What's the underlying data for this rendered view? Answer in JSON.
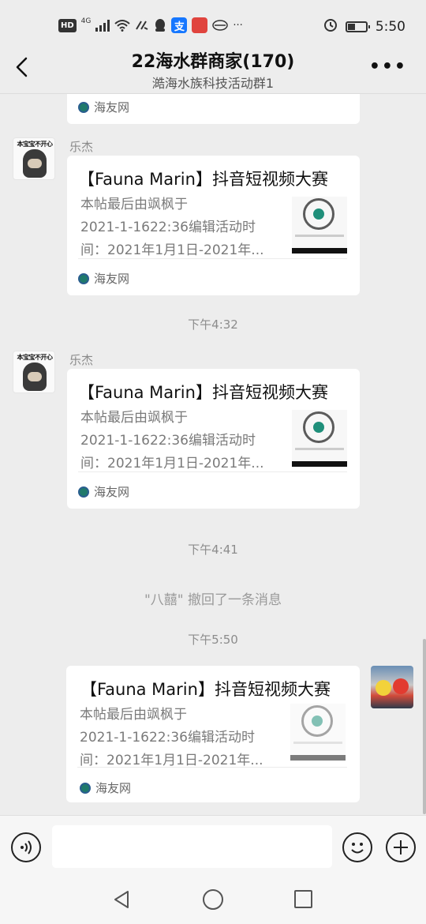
{
  "status_bar": {
    "network_hd": "HD",
    "network_gen": "4G",
    "time": "5:50",
    "icons": [
      "hd-icon",
      "signal-icon",
      "wifi-icon",
      "data-icon",
      "qq-icon",
      "alipay-icon",
      "app-icon",
      "vpn-icon",
      "more-dots-icon",
      "alarm-icon",
      "battery-icon"
    ]
  },
  "header": {
    "title": "22海水群商家(170)",
    "subtitle": "澔海水族科技活动群1",
    "more": "•••"
  },
  "colors": {
    "background": "#ededed",
    "card": "#ffffff",
    "muted_text": "#8c8c8c",
    "source_icon": "#1f7a6b"
  },
  "messages": [
    {
      "type": "card_tail",
      "source": "海友网"
    },
    {
      "type": "card",
      "sender": "乐杰",
      "avatar_caption": "本宝宝不开心",
      "title": "【Fauna Marin】抖音短视频大赛",
      "desc_lines": [
        "本帖最后由飒枫于",
        "2021-1-1622:36编辑活动时",
        "间：2021年1月1日-2021年..."
      ],
      "source": "海友网"
    },
    {
      "type": "timestamp",
      "text": "下午4:32"
    },
    {
      "type": "card",
      "sender": "乐杰",
      "avatar_caption": "本宝宝不开心",
      "title": "【Fauna Marin】抖音短视频大赛",
      "desc_lines": [
        "本帖最后由飒枫于",
        "2021-1-1622:36编辑活动时",
        "间：2021年1月1日-2021年..."
      ],
      "source": "海友网"
    },
    {
      "type": "timestamp",
      "text": "下午4:41"
    },
    {
      "type": "system",
      "text": "\"八囍\" 撤回了一条消息"
    },
    {
      "type": "timestamp",
      "text": "下午5:50"
    },
    {
      "type": "card_self",
      "title": "【Fauna Marin】抖音短视频大赛",
      "desc_lines": [
        "本帖最后由飒枫于",
        "2021-1-1622:36编辑活动时",
        "间：2021年1月1日-2021年..."
      ],
      "source": "海友网"
    }
  ],
  "input_bar": {
    "placeholder": "",
    "icons": [
      "voice-icon",
      "emoji-icon",
      "plus-icon"
    ]
  },
  "system_nav": {
    "icons": [
      "back-triangle-icon",
      "home-circle-icon",
      "recents-square-icon"
    ]
  }
}
